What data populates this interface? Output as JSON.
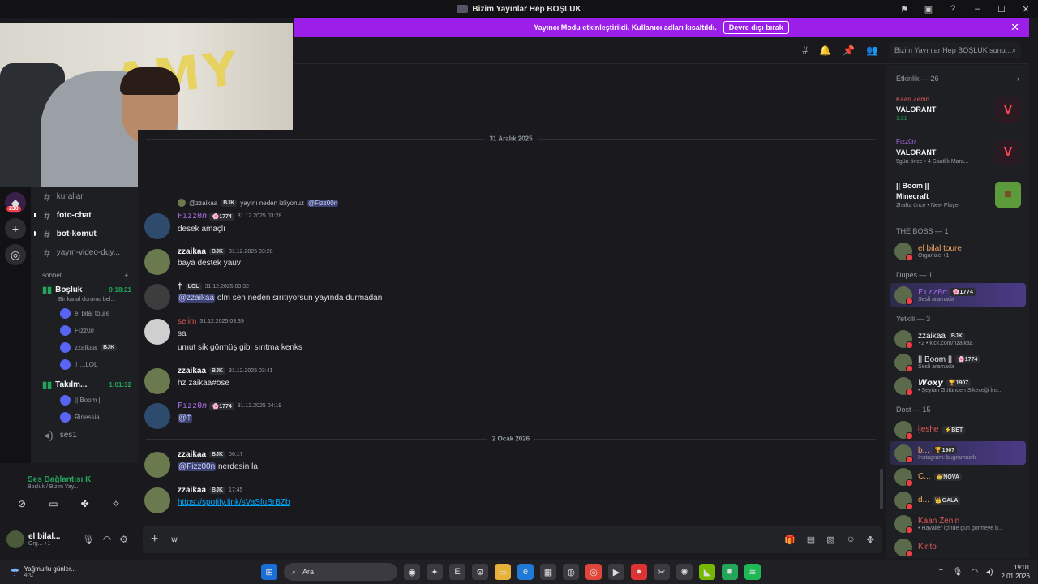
{
  "window": {
    "title": "Bizim Yayınlar Hep BOŞLUK"
  },
  "streamer_mode": {
    "message": "Yayıncı Modu etkinleştirildi. Kullanıcı adları kısaltıldı.",
    "button": "Devre dışı bırak"
  },
  "server_rail": {
    "badge": "230"
  },
  "channels": [
    {
      "name": "kurallar",
      "unread": false
    },
    {
      "name": "foto-chat",
      "unread": true
    },
    {
      "name": "bot-komut",
      "unread": true
    },
    {
      "name": "yayın-video-duy...",
      "unread": false
    }
  ],
  "category": {
    "name": "sohbet"
  },
  "voice_channels": [
    {
      "name": "Boşluk",
      "timer": "9:18:21",
      "status": "Bir kanal durumu bel...",
      "users": [
        "el bilal toure",
        "Fızz0𝑛",
        "zzaikaa",
        "† ...LOL"
      ],
      "user_tags": [
        "",
        "",
        "BJK",
        ""
      ]
    },
    {
      "name": "Takılm...",
      "timer": "1:01:32",
      "users": [
        "|| Boom ||",
        "Rinessia"
      ]
    }
  ],
  "extra_channel": "ses1",
  "voice_panel": {
    "status": "Ses Bağlantısı K",
    "sub": "Boşluk / Bizim Yay..."
  },
  "user_panel": {
    "name": "el bilal...",
    "status": "Org... +1"
  },
  "header": {
    "search_placeholder": "Bizim Yayınlar Hep BOŞLUK sunu..."
  },
  "messages": {
    "divider1": "31 Aralık 2025",
    "divider2": "2 Ocak 2026",
    "items": [
      {
        "user": "Fızz0𝑛",
        "tag": "🌸1774",
        "time": "31.12.2025 03:28",
        "text": "desek amaçlı",
        "reply_user": "@zzaikaa",
        "reply_tag": "BJK",
        "reply_text": "yayını neden izliyonuz",
        "reply_mention": "@Fizz00n"
      },
      {
        "user": "zzaikaa",
        "tag": "BJK",
        "time": "31.12.2025 03:28",
        "text": "baya destek yauv"
      },
      {
        "user": "†",
        "tag": "LOL",
        "time": "31.12.2025 03:32",
        "mention": "@zzaikaa",
        "text": "olm sen neden sırıtıyorsun yayında durmadan"
      },
      {
        "user": "selim",
        "tag": "",
        "time": "31.12.2025 03:39",
        "text": "sa",
        "text2": "umut sik görmüş gibi sırıtma kenks"
      },
      {
        "user": "zzaikaa",
        "tag": "BJK",
        "time": "31.12.2025 03:41",
        "text": "hz zaikaa#bse"
      },
      {
        "user": "Fızz0𝑛",
        "tag": "🌸1774",
        "time": "31.12.2025 04:19",
        "mention": "@†",
        "text": ""
      },
      {
        "user": "zzaikaa",
        "tag": "BJK",
        "time": "06:17",
        "mention": "@Fizz00n",
        "text": "nerdesin la"
      },
      {
        "user": "zzaikaa",
        "tag": "BJK",
        "time": "17:45",
        "link": "https://spotify.link/sVaSfuBrBZb"
      }
    ]
  },
  "composer": {
    "value": "w"
  },
  "members": {
    "activity_header": "Etkinlik — 26",
    "activities": [
      {
        "who": "Kaan Zenin",
        "game": "VALORANT",
        "meta": "1:21"
      },
      {
        "who": "Fızz0𝑛",
        "game": "VALORANT",
        "meta": "5gün önce  •  4 Saatlik Mara..."
      },
      {
        "who": "|| Boom ||",
        "game": "Minecraft",
        "meta": "2hafta önce  •  New Player"
      }
    ],
    "groups": [
      {
        "title": "THE BOSS — 1",
        "members": [
          {
            "name": "el bilal toure",
            "status": "Organize +1",
            "tag": ""
          }
        ]
      },
      {
        "title": "Dupes — 1",
        "members": [
          {
            "name": "Fızz0𝑛",
            "status": "Sesli aramada",
            "tag": "🌸1774"
          }
        ]
      },
      {
        "title": "Yetkili — 3",
        "members": [
          {
            "name": "zzaikaa",
            "status": "+2 • kick.com/hzaikaa",
            "tag": "BJK"
          },
          {
            "name": "|| Boom ||",
            "status": "Sesli aramada",
            "tag": "🌸1774"
          },
          {
            "name": "𝙒𝙤𝙭𝙮",
            "status": "• Şeytan Götünden Sikeceği İns...",
            "tag": "🏆1907"
          }
        ]
      },
      {
        "title": "Dost — 15",
        "members": [
          {
            "name": "ʲjeshe",
            "status": "",
            "tag": "⚡BET"
          },
          {
            "name": "b...",
            "status": "Instagram: bugramuzik",
            "tag": "🏆1907"
          },
          {
            "name": "C...",
            "status": "",
            "tag": "👑NOVA"
          },
          {
            "name": "d...",
            "status": "",
            "tag": "👑GALA"
          },
          {
            "name": "Kaan Zenin",
            "status": "• Hayaller içinde gün görmeye b...",
            "tag": ""
          },
          {
            "name": "Kirito",
            "status": "",
            "tag": ""
          }
        ]
      }
    ]
  },
  "taskbar": {
    "weather_title": "Yağmurlu günler...",
    "weather_temp": "4°C",
    "search": "Ara",
    "time": "19:01",
    "date": "2.01.2026"
  }
}
